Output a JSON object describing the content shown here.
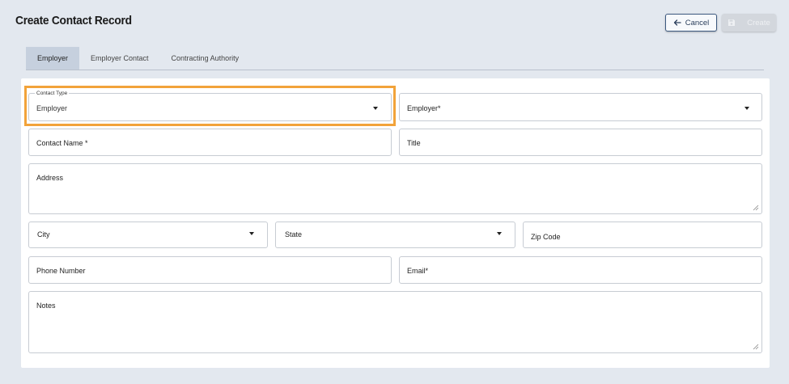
{
  "header": {
    "title": "Create Contact Record",
    "cancel_label": "Cancel",
    "create_label": "Create"
  },
  "tabs": [
    {
      "label": "Employer",
      "active": true
    },
    {
      "label": "Employer Contact",
      "active": false
    },
    {
      "label": "Contracting Authority",
      "active": false
    }
  ],
  "form": {
    "contact_type": {
      "label": "Contact Type",
      "value": "Employer"
    },
    "employer": {
      "label": "Employer*"
    },
    "contact_name": {
      "label": "Contact Name *"
    },
    "title": {
      "label": "Title"
    },
    "address": {
      "label": "Address"
    },
    "city": {
      "label": "City"
    },
    "state": {
      "label": "State"
    },
    "zip": {
      "label": "Zip Code"
    },
    "phone": {
      "label": "Phone Number"
    },
    "email": {
      "label": "Email*"
    },
    "notes": {
      "label": "Notes"
    }
  },
  "colors": {
    "background": "#e3e8ef",
    "accent": "#3d5a80",
    "active_tab": "#c6d0de",
    "highlight": "#f2a33a"
  },
  "icons": {
    "cancel": "arrow-left-icon",
    "create": "save-icon",
    "dropdown": "caret-down-icon"
  }
}
